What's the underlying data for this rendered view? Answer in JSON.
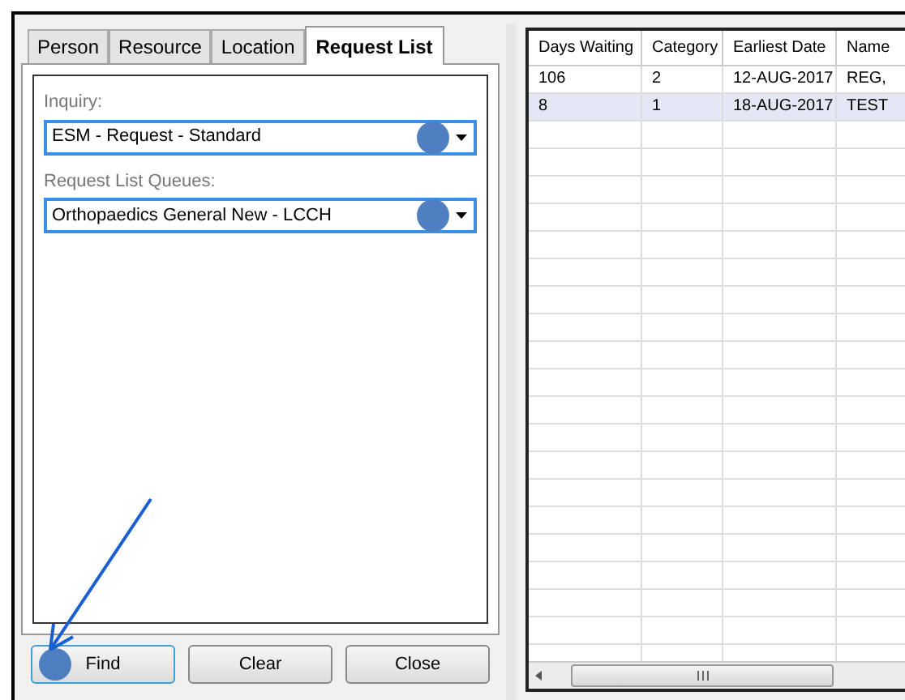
{
  "tabs": [
    {
      "label": "Person",
      "selected": false
    },
    {
      "label": "Resource",
      "selected": false
    },
    {
      "label": "Location",
      "selected": false
    },
    {
      "label": "Request List",
      "selected": true
    }
  ],
  "fields": [
    {
      "label": "Inquiry:",
      "value": "ESM - Request - Standard"
    },
    {
      "label": "Request List Queues:",
      "value": "Orthopaedics General New - LCCH"
    }
  ],
  "buttons": [
    {
      "label": "Find",
      "focused": true
    },
    {
      "label": "Clear",
      "focused": false
    },
    {
      "label": "Close",
      "focused": false
    }
  ],
  "table": {
    "columns": [
      "Days Waiting",
      "Category",
      "Earliest Date",
      "Name"
    ],
    "rows": [
      {
        "cells": [
          "106",
          "2",
          "12-AUG-2017",
          "REG,"
        ],
        "selected": false
      },
      {
        "cells": [
          "8",
          "1",
          "18-AUG-2017",
          "TEST"
        ],
        "selected": true
      }
    ]
  }
}
